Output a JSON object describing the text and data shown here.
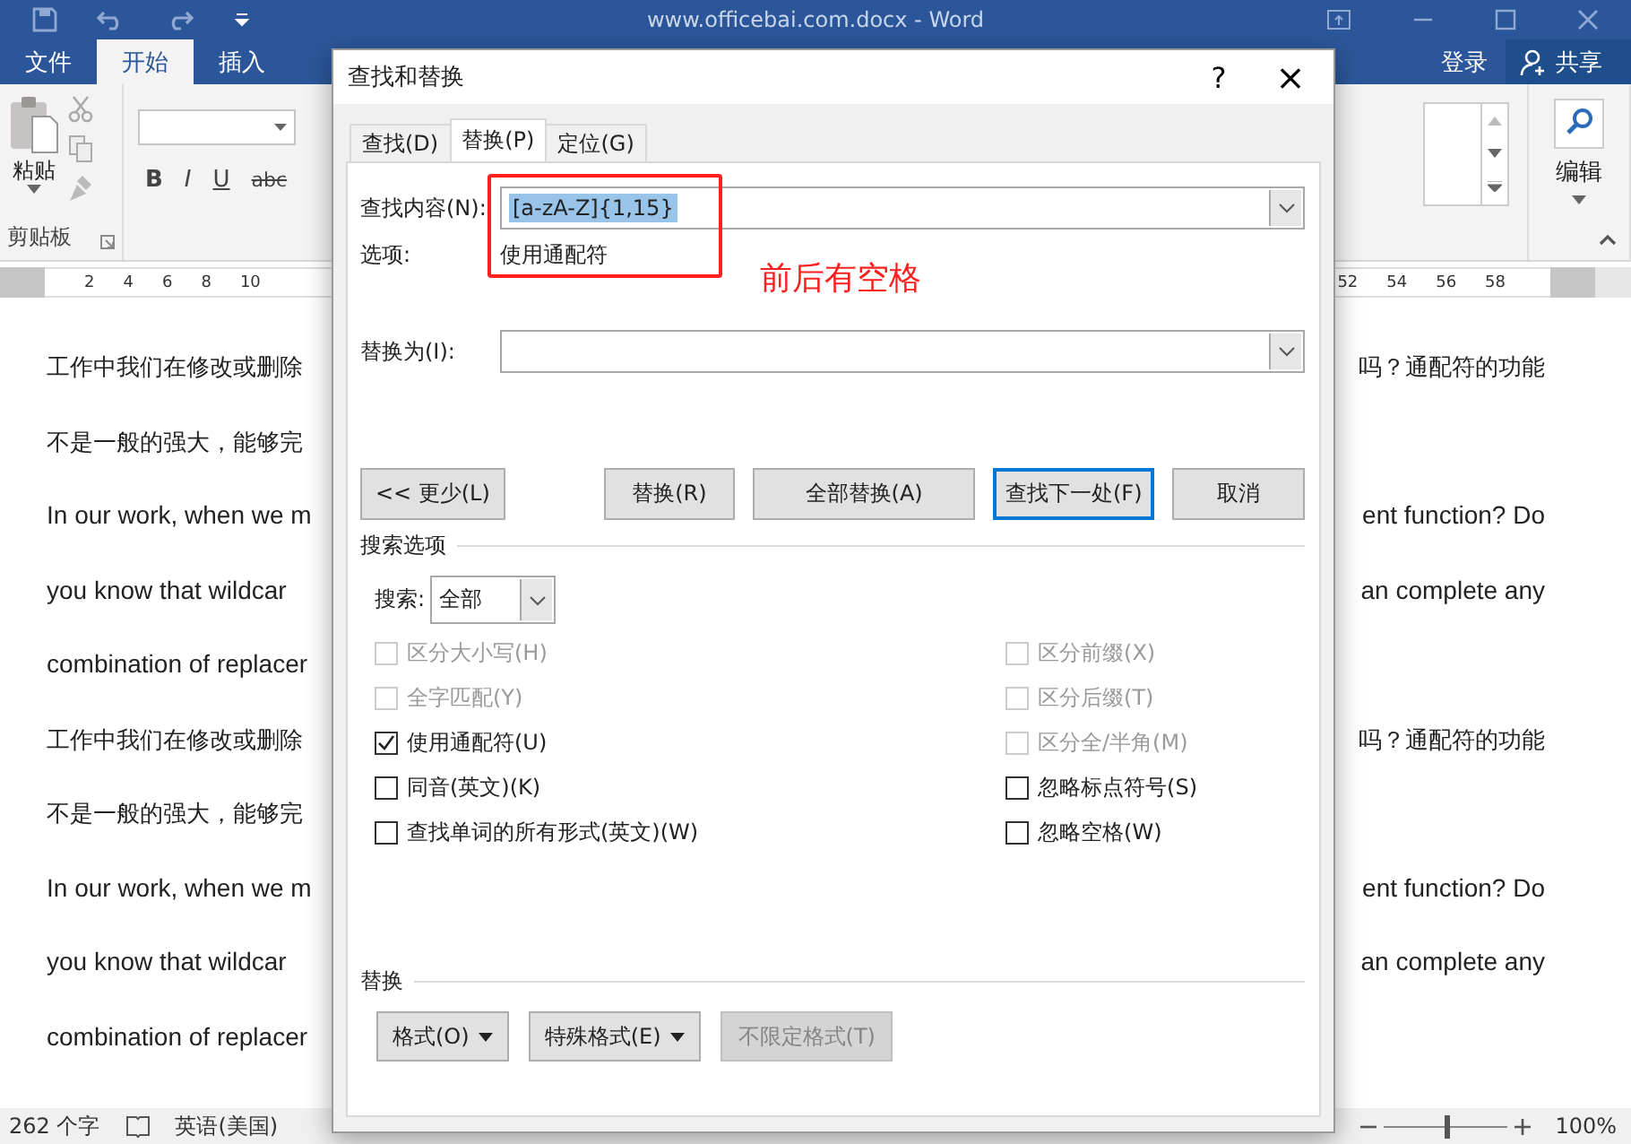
{
  "window": {
    "title": "www.officebai.com.docx - Word"
  },
  "ribbon_tabs": [
    {
      "label": "文件",
      "selected": false
    },
    {
      "label": "开始",
      "selected": true
    },
    {
      "label": "插入",
      "selected": false
    }
  ],
  "account": {
    "sign_in": "登录",
    "share": "共享"
  },
  "ribbon": {
    "paste": "粘贴",
    "clipboard_group": "剪贴板",
    "format_buttons": [
      "B",
      "I",
      "U",
      "abc"
    ],
    "editing": "编辑"
  },
  "ruler": {
    "left_ticks": [
      "2",
      "4",
      "6",
      "8",
      "10"
    ],
    "right_ticks": [
      "52",
      "54",
      "56",
      "58"
    ]
  },
  "document": {
    "lines": [
      {
        "left": "工作中我们在修改或删除",
        "right": "吗？通配符的功能",
        "kind": "cjk"
      },
      {
        "left": "不是一般的强大，能够完",
        "kind": "cjk"
      },
      {
        "left": "In our work, when we m",
        "right": "ent function? Do",
        "kind": "latin"
      },
      {
        "left": "you know that wildcar",
        "right": "an complete any",
        "kind": "latin"
      },
      {
        "left": "combination of replacer",
        "kind": "latin"
      },
      {
        "left": "工作中我们在修改或删除",
        "right": "吗？通配符的功能",
        "kind": "cjk"
      },
      {
        "left": "不是一般的强大，能够完",
        "kind": "cjk"
      },
      {
        "left": "In our work, when we m",
        "right": "ent function? Do",
        "kind": "latin"
      },
      {
        "left": "you know that wildcar",
        "right": "an complete any",
        "kind": "latin"
      },
      {
        "left": "combination of replacer",
        "kind": "latin"
      }
    ]
  },
  "status_bar": {
    "word_count": "262 个字",
    "language": "英语(美国)",
    "zoom_slider": {
      "level": 0.5
    },
    "zoom": "100%"
  },
  "dialog": {
    "title": "查找和替换",
    "help": "?",
    "close": "×",
    "tabs": [
      {
        "label": "查找(D)",
        "selected": false
      },
      {
        "label": "替换(P)",
        "selected": true
      },
      {
        "label": "定位(G)",
        "selected": false
      }
    ],
    "find_label": "查找内容(N):",
    "find_value": "[a-zA-Z]{1,15}",
    "options_label": "选项:",
    "options_value": "使用通配符",
    "annotation": "前后有空格",
    "replace_label": "替换为(I):",
    "buttons": [
      {
        "label": "<< 更少(L)",
        "default": false
      },
      {
        "label": "替换(R)",
        "default": false
      },
      {
        "label": "全部替换(A)",
        "default": false
      },
      {
        "label": "查找下一处(F)",
        "default": true
      },
      {
        "label": "取消",
        "default": false
      }
    ],
    "search_options_heading": "搜索选项",
    "search_label": "搜索:",
    "search_value": "全部",
    "options_left": [
      {
        "label": "区分大小写(H)",
        "checked": false,
        "disabled": true
      },
      {
        "label": "全字匹配(Y)",
        "checked": false,
        "disabled": true
      },
      {
        "label": "使用通配符(U)",
        "checked": true,
        "disabled": false
      },
      {
        "label": "同音(英文)(K)",
        "checked": false,
        "disabled": false
      },
      {
        "label": "查找单词的所有形式(英文)(W)",
        "checked": false,
        "disabled": false
      }
    ],
    "options_right": [
      {
        "label": "区分前缀(X)",
        "checked": false,
        "disabled": true
      },
      {
        "label": "区分后缀(T)",
        "checked": false,
        "disabled": true
      },
      {
        "label": "区分全/半角(M)",
        "checked": false,
        "disabled": true
      },
      {
        "label": "忽略标点符号(S)",
        "checked": false,
        "disabled": false
      },
      {
        "label": "忽略空格(W)",
        "checked": false,
        "disabled": false
      }
    ],
    "replace_heading": "替换",
    "replace_buttons": [
      {
        "label": "格式(O)",
        "dropdown": true,
        "disabled": false
      },
      {
        "label": "特殊格式(E)",
        "dropdown": true,
        "disabled": false
      },
      {
        "label": "不限定格式(T)",
        "dropdown": false,
        "disabled": true
      }
    ]
  }
}
